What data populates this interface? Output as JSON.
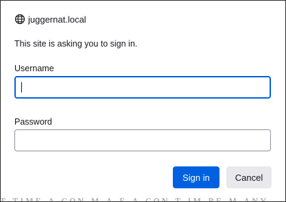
{
  "dialog": {
    "origin": "juggernat.local",
    "origin_icon": "globe-icon",
    "message": "This site is asking you to sign in.",
    "username_label": "Username",
    "username_value": "",
    "password_label": "Password",
    "password_value": "",
    "signin_label": "Sign in",
    "cancel_label": "Cancel"
  },
  "colors": {
    "accent": "#0061e0",
    "secondary_button": "#e9e9ed",
    "text": "#15141a",
    "field_border": "#8f8f9d"
  }
}
